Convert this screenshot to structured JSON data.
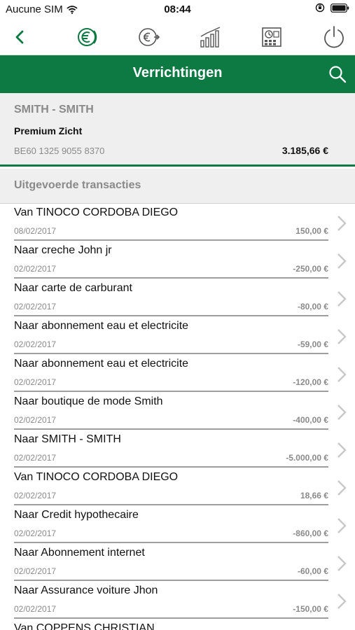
{
  "status_bar": {
    "carrier": "Aucune SIM",
    "time": "08:44"
  },
  "toolbar": {
    "buttons": [
      {
        "icon": "back-arrow-icon"
      },
      {
        "icon": "euro-exchange-icon"
      },
      {
        "icon": "euro-transfer-icon"
      },
      {
        "icon": "bar-chart-icon"
      },
      {
        "icon": "calculator-icon"
      },
      {
        "icon": "power-icon"
      }
    ]
  },
  "header": {
    "title": "Verrichtingen",
    "search_icon": "search-icon"
  },
  "account": {
    "holder": "SMITH - SMITH",
    "type": "Premium Zicht",
    "iban": "BE60 1325 9055 8370",
    "balance": "3.185,66 €"
  },
  "section": {
    "title": "Uitgevoerde transacties"
  },
  "transactions": [
    {
      "description": "Van TINOCO CORDOBA DIEGO",
      "date": "08/02/2017",
      "amount": "150,00 €"
    },
    {
      "description": "Naar creche John jr",
      "date": "02/02/2017",
      "amount": "-250,00 €"
    },
    {
      "description": "Naar carte de carburant",
      "date": "02/02/2017",
      "amount": "-80,00 €"
    },
    {
      "description": "Naar abonnement eau et electricite",
      "date": "02/02/2017",
      "amount": "-59,00 €"
    },
    {
      "description": "Naar abonnement eau et electricite",
      "date": "02/02/2017",
      "amount": "-120,00 €"
    },
    {
      "description": "Naar boutique de mode Smith",
      "date": "02/02/2017",
      "amount": "-400,00 €"
    },
    {
      "description": "Naar SMITH - SMITH",
      "date": "02/02/2017",
      "amount": "-5.000,00 €"
    },
    {
      "description": "Van TINOCO CORDOBA DIEGO",
      "date": "02/02/2017",
      "amount": "18,66 €"
    },
    {
      "description": "Naar Credit hypothecaire",
      "date": "02/02/2017",
      "amount": "-860,00 €"
    },
    {
      "description": "Naar Abonnement internet",
      "date": "02/02/2017",
      "amount": "-60,00 €"
    },
    {
      "description": "Naar Assurance voiture Jhon",
      "date": "02/02/2017",
      "amount": "-150,00 €"
    },
    {
      "description": "Van COPPENS CHRISTIAN",
      "date": "",
      "amount": ""
    }
  ],
  "colors": {
    "brand_green": "#0d7a43",
    "panel_gray": "#efefef",
    "muted_text": "#8a8a8a"
  }
}
